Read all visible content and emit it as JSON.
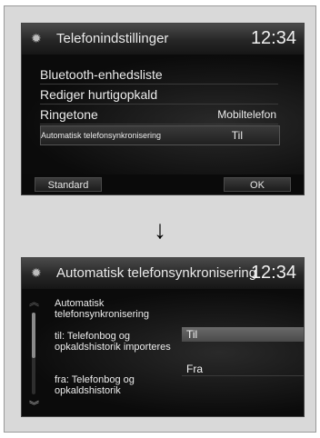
{
  "screen1": {
    "title": "Telefonindstillinger",
    "clock": "12:34",
    "menu": [
      {
        "label": "Bluetooth-enhedsliste",
        "value": ""
      },
      {
        "label": "Rediger hurtigopkald",
        "value": ""
      },
      {
        "label": "Ringetone",
        "value": "Mobiltelefon"
      },
      {
        "label": "Automatisk telefonsynkronisering",
        "value": "Til"
      }
    ],
    "left_button": "Standard",
    "right_button": "OK"
  },
  "arrow": "↓",
  "screen2": {
    "title": "Automatisk telefonsynkronisering",
    "clock": "12:34",
    "help": [
      "Automatisk telefonsynkronisering",
      "til: Telefonbog og opkaldshistorik importeres",
      "fra: Telefonbog og opkaldshistorik"
    ],
    "options": [
      "Til",
      "Fra"
    ],
    "selected_option": "Til"
  },
  "icons": {
    "gear": "gear-icon",
    "scroll_up": "chevron-up-icon",
    "scroll_down": "chevron-down-icon"
  }
}
